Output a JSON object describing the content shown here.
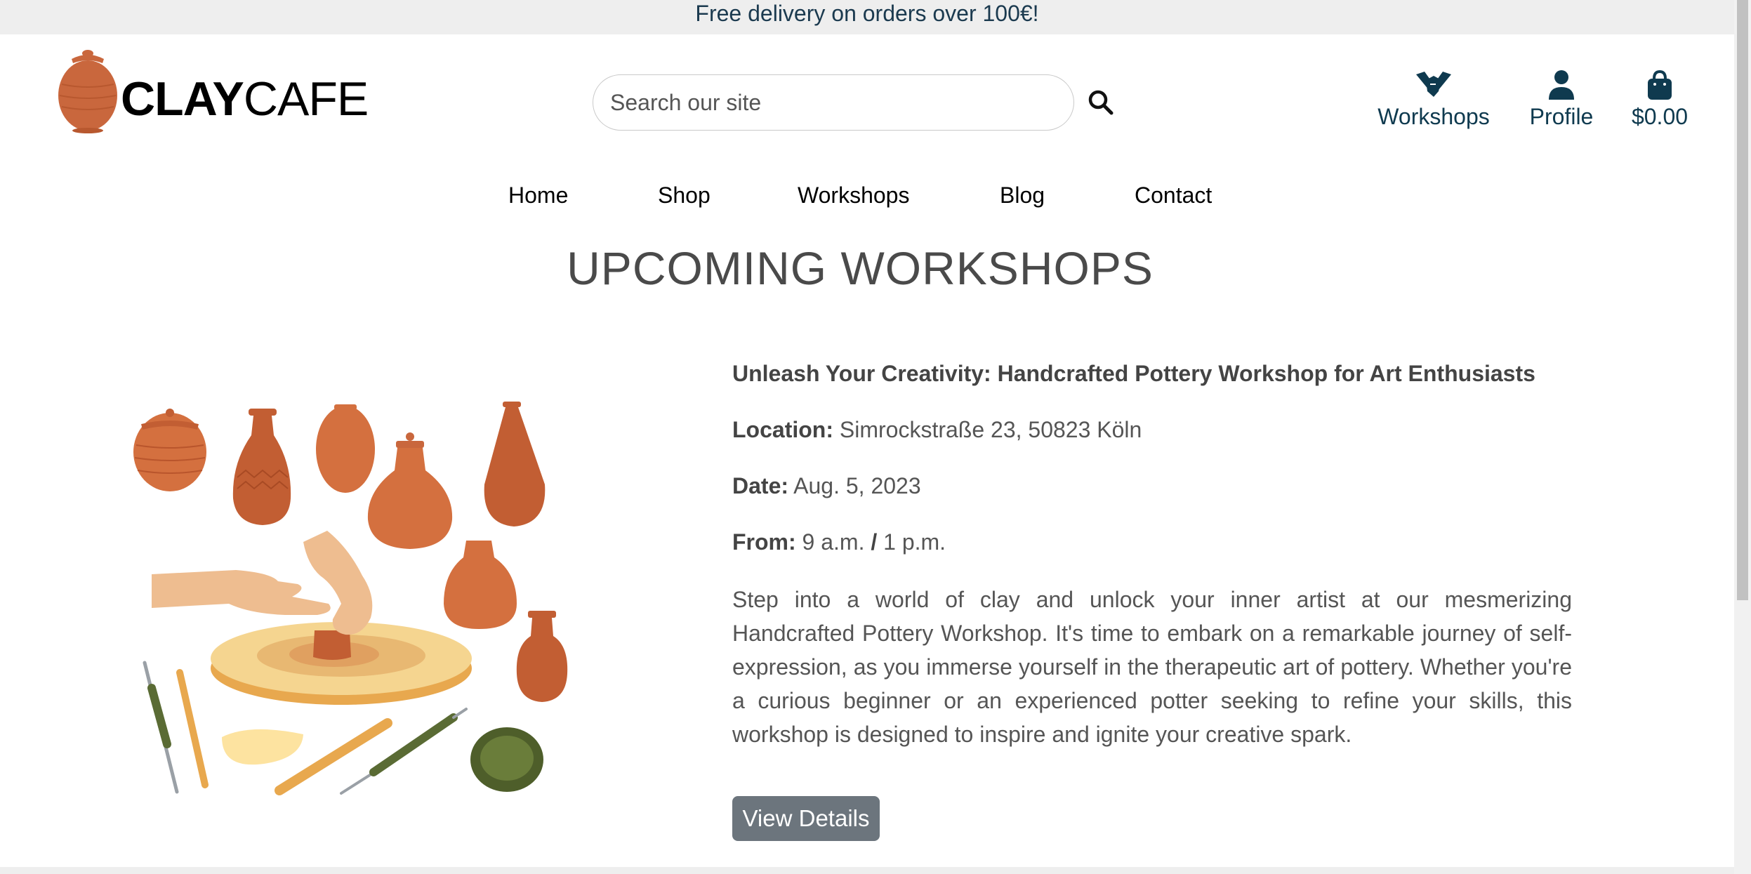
{
  "banner": {
    "text": "Free delivery on orders over 100€!"
  },
  "brand": {
    "name_bold": "CLAY",
    "name_regular": "CAFE"
  },
  "search": {
    "placeholder": "Search our site"
  },
  "header_links": {
    "workshops": {
      "label": "Workshops",
      "icon": "handshake-icon"
    },
    "profile": {
      "label": "Profile",
      "icon": "user-icon"
    },
    "cart": {
      "label": "$0.00",
      "icon": "shopping-bag-icon"
    }
  },
  "nav": {
    "home": "Home",
    "shop": "Shop",
    "workshops": "Workshops",
    "blog": "Blog",
    "contact": "Contact"
  },
  "page": {
    "title": "UPCOMING WORKSHOPS"
  },
  "workshop": {
    "title": "Unleash Your Creativity: Handcrafted Pottery Workshop for Art Enthusiasts",
    "location_label": "Location:",
    "location": "Simrockstraße 23, 50823 Köln",
    "date_label": "Date:",
    "date": "Aug. 5, 2023",
    "from_label": "From:",
    "from_start": "9 a.m.",
    "from_sep": "/",
    "from_end": "1 p.m.",
    "description": "Step into a world of clay and unlock your inner artist at our mesmerizing Handcrafted Pottery Workshop. It's time to embark on a remarkable journey of self-expression, as you immerse yourself in the therapeutic art of pottery. Whether you're a curious beginner or an experienced potter seeking to refine your skills, this workshop is designed to inspire and ignite your creative spark.",
    "button": "View Details"
  },
  "colors": {
    "brand_dark": "#0f3a4f",
    "clay": "#c9673d",
    "button": "#6c757d"
  }
}
